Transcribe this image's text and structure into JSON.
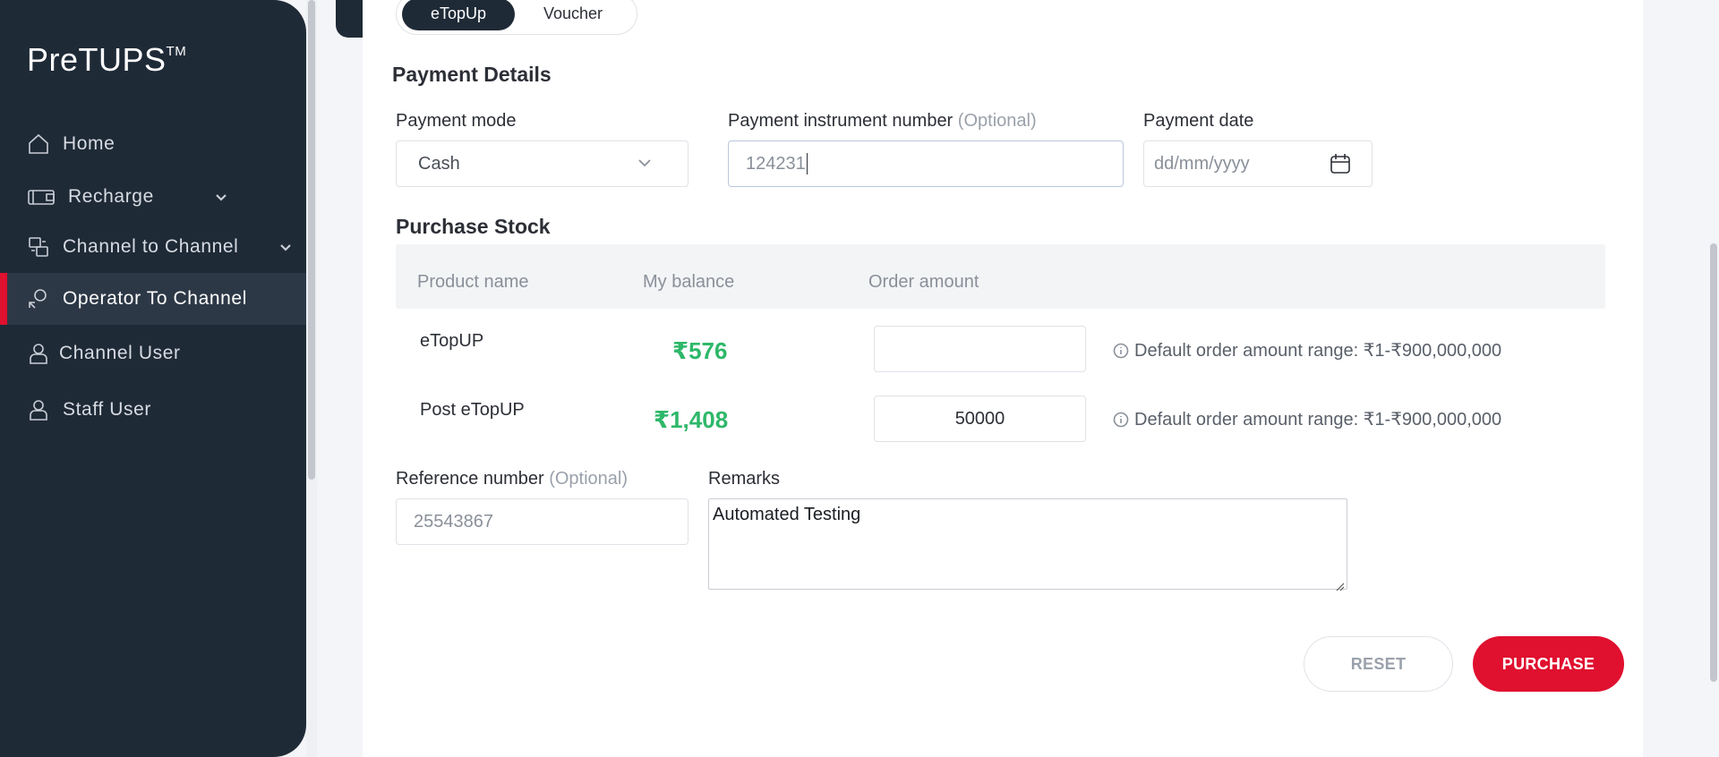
{
  "app": {
    "logo_text": "PreTUPS",
    "logo_tm": "TM"
  },
  "sidebar": {
    "items": [
      {
        "label": "Home",
        "icon": "home-icon",
        "active": false,
        "expandable": false
      },
      {
        "label": "Recharge",
        "icon": "wallet-icon",
        "active": false,
        "expandable": true
      },
      {
        "label": "Channel to Channel",
        "icon": "transfer-icon",
        "active": false,
        "expandable": true
      },
      {
        "label": "Operator To Channel",
        "icon": "operator-icon",
        "active": true,
        "expandable": false
      },
      {
        "label": "Channel User",
        "icon": "user-icon",
        "active": false,
        "expandable": false
      },
      {
        "label": "Staff User",
        "icon": "user-icon",
        "active": false,
        "expandable": false
      }
    ]
  },
  "tabs": [
    {
      "label": "eTopUp",
      "active": true
    },
    {
      "label": "Voucher",
      "active": false
    }
  ],
  "payment": {
    "title": "Payment Details",
    "mode_label": "Payment mode",
    "mode_value": "Cash",
    "instrument_label": "Payment instrument number",
    "instrument_optional": "(Optional)",
    "instrument_value": "124231",
    "date_label": "Payment date",
    "date_placeholder": "dd/mm/yyyy"
  },
  "stock": {
    "title": "Purchase Stock",
    "headers": [
      "Product name",
      "My balance",
      "Order amount"
    ],
    "rows": [
      {
        "product": "eTopUP",
        "balance": "₹576",
        "amount": "",
        "hint": "Default order amount range: ₹1-₹900,000,000"
      },
      {
        "product": "Post eTopUP",
        "balance": "₹1,408",
        "amount": "50000",
        "hint": "Default order amount range: ₹1-₹900,000,000"
      }
    ]
  },
  "reference": {
    "label": "Reference number",
    "optional": "(Optional)",
    "value": "25543867"
  },
  "remarks": {
    "label": "Remarks",
    "value": "Automated Testing"
  },
  "actions": {
    "reset_label": "RESET",
    "purchase_label": "PURCHASE"
  },
  "colors": {
    "sidebar_bg": "#1f2a37",
    "accent_red": "#e0102f",
    "balance_green": "#2eb86a"
  }
}
